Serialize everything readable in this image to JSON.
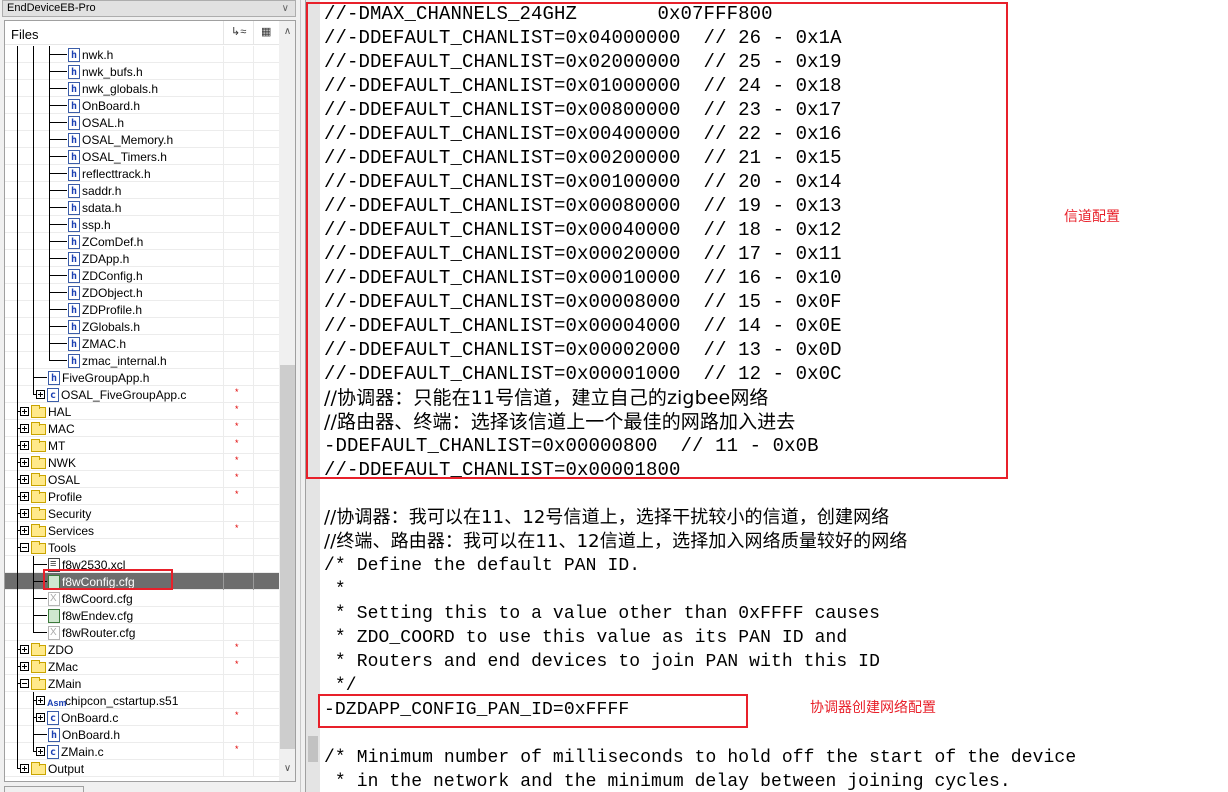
{
  "workspace": {
    "project_name": "EndDeviceEB-Pro",
    "files_header": "Files",
    "header_icons": [
      "options-icon",
      "overview-icon"
    ],
    "tree": [
      {
        "name": "nwk.h",
        "icon": "h-file",
        "depth": 3,
        "mod": false
      },
      {
        "name": "nwk_bufs.h",
        "icon": "h-file",
        "depth": 3,
        "mod": false
      },
      {
        "name": "nwk_globals.h",
        "icon": "h-file",
        "depth": 3,
        "mod": false
      },
      {
        "name": "OnBoard.h",
        "icon": "h-file",
        "depth": 3,
        "mod": false
      },
      {
        "name": "OSAL.h",
        "icon": "h-file",
        "depth": 3,
        "mod": false
      },
      {
        "name": "OSAL_Memory.h",
        "icon": "h-file",
        "depth": 3,
        "mod": false
      },
      {
        "name": "OSAL_Timers.h",
        "icon": "h-file",
        "depth": 3,
        "mod": false
      },
      {
        "name": "reflecttrack.h",
        "icon": "h-file",
        "depth": 3,
        "mod": false
      },
      {
        "name": "saddr.h",
        "icon": "h-file",
        "depth": 3,
        "mod": false
      },
      {
        "name": "sdata.h",
        "icon": "h-file",
        "depth": 3,
        "mod": false
      },
      {
        "name": "ssp.h",
        "icon": "h-file",
        "depth": 3,
        "mod": false
      },
      {
        "name": "ZComDef.h",
        "icon": "h-file",
        "depth": 3,
        "mod": false
      },
      {
        "name": "ZDApp.h",
        "icon": "h-file",
        "depth": 3,
        "mod": false
      },
      {
        "name": "ZDConfig.h",
        "icon": "h-file",
        "depth": 3,
        "mod": false
      },
      {
        "name": "ZDObject.h",
        "icon": "h-file",
        "depth": 3,
        "mod": false
      },
      {
        "name": "ZDProfile.h",
        "icon": "h-file",
        "depth": 3,
        "mod": false
      },
      {
        "name": "ZGlobals.h",
        "icon": "h-file",
        "depth": 3,
        "mod": false
      },
      {
        "name": "ZMAC.h",
        "icon": "h-file",
        "depth": 3,
        "mod": false
      },
      {
        "name": "zmac_internal.h",
        "icon": "h-file",
        "depth": 3,
        "mod": false
      },
      {
        "name": "FiveGroupApp.h",
        "icon": "h-file",
        "depth": 2,
        "mod": false
      },
      {
        "name": "OSAL_FiveGroupApp.c",
        "icon": "c-file",
        "depth": 2,
        "mod": true,
        "expander": "plus"
      },
      {
        "name": "HAL",
        "icon": "folder",
        "depth": 1,
        "mod": true,
        "expander": "plus"
      },
      {
        "name": "MAC",
        "icon": "folder",
        "depth": 1,
        "mod": true,
        "expander": "plus"
      },
      {
        "name": "MT",
        "icon": "folder",
        "depth": 1,
        "mod": true,
        "expander": "plus"
      },
      {
        "name": "NWK",
        "icon": "folder",
        "depth": 1,
        "mod": true,
        "expander": "plus"
      },
      {
        "name": "OSAL",
        "icon": "folder",
        "depth": 1,
        "mod": true,
        "expander": "plus"
      },
      {
        "name": "Profile",
        "icon": "folder",
        "depth": 1,
        "mod": true,
        "expander": "plus"
      },
      {
        "name": "Security",
        "icon": "folder",
        "depth": 1,
        "mod": false,
        "expander": "plus"
      },
      {
        "name": "Services",
        "icon": "folder",
        "depth": 1,
        "mod": true,
        "expander": "plus"
      },
      {
        "name": "Tools",
        "icon": "folder",
        "depth": 1,
        "mod": false,
        "expander": "minus"
      },
      {
        "name": "f8w2530.xcl",
        "icon": "xcl-file",
        "depth": 2,
        "mod": false
      },
      {
        "name": "f8wConfig.cfg",
        "icon": "cfg-file",
        "depth": 2,
        "mod": false,
        "selected": true
      },
      {
        "name": "f8wCoord.cfg",
        "icon": "cfg-excluded",
        "depth": 2,
        "mod": false
      },
      {
        "name": "f8wEndev.cfg",
        "icon": "cfg-file",
        "depth": 2,
        "mod": false
      },
      {
        "name": "f8wRouter.cfg",
        "icon": "cfg-excluded",
        "depth": 2,
        "mod": false
      },
      {
        "name": "ZDO",
        "icon": "folder",
        "depth": 1,
        "mod": true,
        "expander": "plus"
      },
      {
        "name": "ZMac",
        "icon": "folder",
        "depth": 1,
        "mod": true,
        "expander": "plus"
      },
      {
        "name": "ZMain",
        "icon": "folder",
        "depth": 1,
        "mod": false,
        "expander": "minus"
      },
      {
        "name": "chipcon_cstartup.s51",
        "icon": "asm-file",
        "depth": 2,
        "mod": false,
        "expander": "plus"
      },
      {
        "name": "OnBoard.c",
        "icon": "c-file",
        "depth": 2,
        "mod": true,
        "expander": "plus"
      },
      {
        "name": "OnBoard.h",
        "icon": "h-file",
        "depth": 2,
        "mod": false
      },
      {
        "name": "ZMain.c",
        "icon": "c-file",
        "depth": 2,
        "mod": true,
        "expander": "plus"
      },
      {
        "name": "Output",
        "icon": "folder",
        "depth": 1,
        "mod": false,
        "expander": "plus"
      }
    ],
    "modified_marker": "*"
  },
  "editor": {
    "lines": [
      "//-DMAX_CHANNELS_24GHZ       0x07FFF800",
      "//-DDEFAULT_CHANLIST=0x04000000  // 26 - 0x1A",
      "//-DDEFAULT_CHANLIST=0x02000000  // 25 - 0x19",
      "//-DDEFAULT_CHANLIST=0x01000000  // 24 - 0x18",
      "//-DDEFAULT_CHANLIST=0x00800000  // 23 - 0x17",
      "//-DDEFAULT_CHANLIST=0x00400000  // 22 - 0x16",
      "//-DDEFAULT_CHANLIST=0x00200000  // 21 - 0x15",
      "//-DDEFAULT_CHANLIST=0x00100000  // 20 - 0x14",
      "//-DDEFAULT_CHANLIST=0x00080000  // 19 - 0x13",
      "//-DDEFAULT_CHANLIST=0x00040000  // 18 - 0x12",
      "//-DDEFAULT_CHANLIST=0x00020000  // 17 - 0x11",
      "//-DDEFAULT_CHANLIST=0x00010000  // 16 - 0x10",
      "//-DDEFAULT_CHANLIST=0x00008000  // 15 - 0x0F",
      "//-DDEFAULT_CHANLIST=0x00004000  // 14 - 0x0E",
      "//-DDEFAULT_CHANLIST=0x00002000  // 13 - 0x0D",
      "//-DDEFAULT_CHANLIST=0x00001000  // 12 - 0x0C",
      "//协调器：只能在11号信道，建立自己的zigbee网络",
      "//路由器、终端：选择该信道上一个最佳的网路加入进去",
      "-DDEFAULT_CHANLIST=0x00000800  // 11 - 0x0B",
      "//-DDEFAULT_CHANLIST=0x00001800",
      "",
      "//协调器：我可以在11、12号信道上，选择干扰较小的信道，创建网络",
      "//终端、路由器：我可以在11、12信道上，选择加入网络质量较好的网络",
      "/* Define the default PAN ID.",
      " *",
      " * Setting this to a value other than 0xFFFF causes",
      " * ZDO_COORD to use this value as its PAN ID and",
      " * Routers and end devices to join PAN with this ID",
      " */",
      "-DZDAPP_CONFIG_PAN_ID=0xFFFF",
      "",
      "/* Minimum number of milliseconds to hold off the start of the device",
      " * in the network and the minimum delay between joining cycles."
    ]
  },
  "annotations": {
    "channel_config": "信道配置",
    "coordinator_network_config": "协调器创建网络配置"
  },
  "colors": {
    "highlight_box": "#e8202a",
    "selected_row": "#6d6d6d",
    "modified_star": "#e00000"
  }
}
